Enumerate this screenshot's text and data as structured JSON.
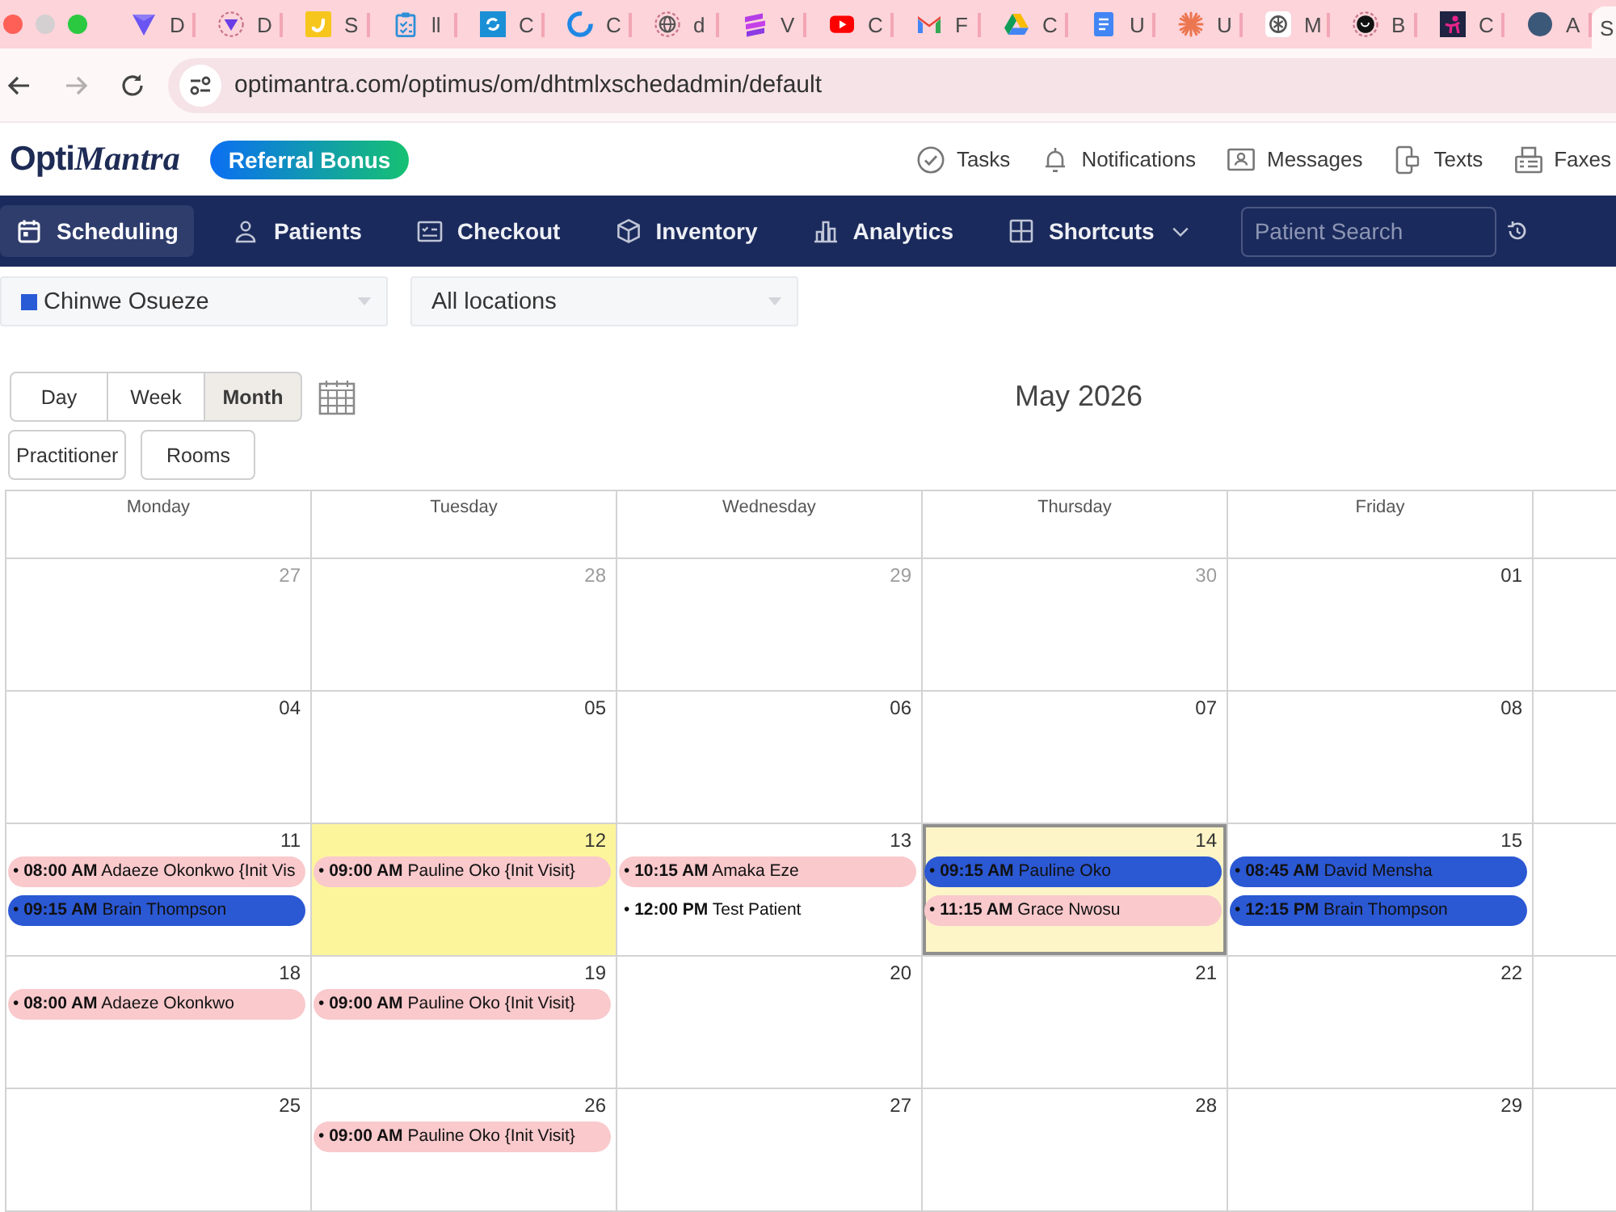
{
  "browser": {
    "tabs": [
      {
        "label": "D",
        "selected": false
      },
      {
        "label": "D",
        "selected": false
      },
      {
        "label": "S",
        "selected": false
      },
      {
        "label": "ll",
        "selected": false
      },
      {
        "label": "C",
        "selected": false
      },
      {
        "label": "C",
        "selected": false
      },
      {
        "label": "d",
        "selected": false
      },
      {
        "label": "V",
        "selected": false
      },
      {
        "label": "C",
        "selected": false
      },
      {
        "label": "F",
        "selected": false
      },
      {
        "label": "C",
        "selected": false
      },
      {
        "label": "U",
        "selected": false
      },
      {
        "label": "U",
        "selected": false
      },
      {
        "label": "M",
        "selected": false
      },
      {
        "label": "B",
        "selected": false
      },
      {
        "label": "C",
        "selected": false
      },
      {
        "label": "A",
        "selected": false
      },
      {
        "label": "S",
        "selected": true
      }
    ],
    "nav_buttons": [
      {
        "kind": "back",
        "disabled": false
      },
      {
        "kind": "forward",
        "disabled": true
      },
      {
        "kind": "reload",
        "disabled": false
      }
    ],
    "url": "optimantra.com/optimus/om/dhtmlxschedadmin/default"
  },
  "app_header": {
    "logo": {
      "text": "Opti",
      "accent": "Mantra"
    },
    "promo_button": "Referral Bonus",
    "links": [
      {
        "label": "Tasks"
      },
      {
        "label": "Notifications"
      },
      {
        "label": "Messages"
      },
      {
        "label": "Texts"
      },
      {
        "label": "Faxes"
      }
    ]
  },
  "nav": {
    "items": [
      {
        "label": "Scheduling",
        "selected": true,
        "dropdown": false
      },
      {
        "label": "Patients",
        "selected": false,
        "dropdown": false
      },
      {
        "label": "Checkout",
        "selected": false,
        "dropdown": false
      },
      {
        "label": "Inventory",
        "selected": false,
        "dropdown": false
      },
      {
        "label": "Analytics",
        "selected": false,
        "dropdown": false
      },
      {
        "label": "Shortcuts",
        "selected": false,
        "dropdown": true
      }
    ],
    "search": {
      "placeholder": "Patient Search"
    }
  },
  "filters": [
    {
      "value": "Chinwe Osueze",
      "color": "#2a5bd6"
    },
    {
      "value": "All locations"
    }
  ],
  "views": [
    {
      "label": "Day",
      "selected": false
    },
    {
      "label": "Week",
      "selected": false
    },
    {
      "label": "Month",
      "selected": true
    }
  ],
  "title": "May 2026",
  "modes": [
    {
      "label": "Practitioner"
    },
    {
      "label": "Rooms"
    }
  ],
  "calendar": {
    "weekdays": [
      "Monday",
      "Tuesday",
      "Wednesday",
      "Thursday",
      "Friday"
    ],
    "weeks": [
      {
        "days": [
          {
            "date": "27",
            "other_month": true,
            "selected": false,
            "today": false
          },
          {
            "date": "28",
            "other_month": true,
            "selected": false,
            "today": false
          },
          {
            "date": "29",
            "other_month": true,
            "selected": false,
            "today": false
          },
          {
            "date": "30",
            "other_month": true,
            "selected": false,
            "today": false
          },
          {
            "date": "01",
            "other_month": false,
            "selected": false,
            "today": false
          }
        ]
      },
      {
        "days": [
          {
            "date": "04",
            "other_month": false,
            "selected": false,
            "today": false
          },
          {
            "date": "05",
            "other_month": false,
            "selected": false,
            "today": false
          },
          {
            "date": "06",
            "other_month": false,
            "selected": false,
            "today": false
          },
          {
            "date": "07",
            "other_month": false,
            "selected": false,
            "today": false
          },
          {
            "date": "08",
            "other_month": false,
            "selected": false,
            "today": false
          }
        ]
      },
      {
        "days": [
          {
            "date": "11",
            "other_month": false,
            "selected": false,
            "today": false,
            "events": [
              {
                "text": "• **08:00 AM** Adaeze Okonkwo {Init Vis",
                "color": "#f9c9cc"
              },
              {
                "text": "• **09:15 AM** Brain Thompson",
                "color": "#2b58d3"
              }
            ]
          },
          {
            "date": "12",
            "other_month": false,
            "selected": true,
            "today": false,
            "events": [
              {
                "text": "• **09:00 AM** Pauline Oko {Init Visit}",
                "color": "#f9c9cc"
              }
            ]
          },
          {
            "date": "13",
            "other_month": false,
            "selected": false,
            "today": false,
            "events": [
              {
                "text": "• **10:15 AM** Amaka Eze",
                "color": "#f9c9cc"
              },
              {
                "text": "• **12:00 PM** Test Patient"
              }
            ]
          },
          {
            "date": "14",
            "other_month": false,
            "selected": false,
            "today": true,
            "events": [
              {
                "text": "• **09:15 AM** Pauline Oko",
                "color": "#2b58d3"
              },
              {
                "text": "• **11:15 AM** Grace Nwosu",
                "color": "#f9c9cc"
              }
            ]
          },
          {
            "date": "15",
            "other_month": false,
            "selected": false,
            "today": false,
            "events": [
              {
                "text": "• **08:45 AM** David Mensha",
                "color": "#2b58d3"
              },
              {
                "text": "• **12:15 PM** Brain Thompson",
                "color": "#2b58d3"
              }
            ]
          }
        ]
      },
      {
        "days": [
          {
            "date": "18",
            "other_month": false,
            "selected": false,
            "today": false,
            "events": [
              {
                "text": "• **08:00 AM** Adaeze Okonkwo",
                "color": "#f9c9cc"
              }
            ]
          },
          {
            "date": "19",
            "other_month": false,
            "selected": false,
            "today": false,
            "events": [
              {
                "text": "• **09:00 AM** Pauline Oko {Init Visit}",
                "color": "#f9c9cc"
              }
            ]
          },
          {
            "date": "20",
            "other_month": false,
            "selected": false,
            "today": false
          },
          {
            "date": "21",
            "other_month": false,
            "selected": false,
            "today": false
          },
          {
            "date": "22",
            "other_month": false,
            "selected": false,
            "today": false
          }
        ]
      },
      {
        "days": [
          {
            "date": "25",
            "other_month": false,
            "selected": false,
            "today": false
          },
          {
            "date": "26",
            "other_month": false,
            "selected": false,
            "today": false,
            "events": [
              {
                "text": "• **09:00 AM** Pauline Oko {Init Visit}",
                "color": "#f9c9cc"
              }
            ]
          },
          {
            "date": "27",
            "other_month": false,
            "selected": false,
            "today": false
          },
          {
            "date": "28",
            "other_month": false,
            "selected": false,
            "today": false
          },
          {
            "date": "29",
            "other_month": false,
            "selected": false,
            "today": false
          }
        ]
      }
    ]
  }
}
